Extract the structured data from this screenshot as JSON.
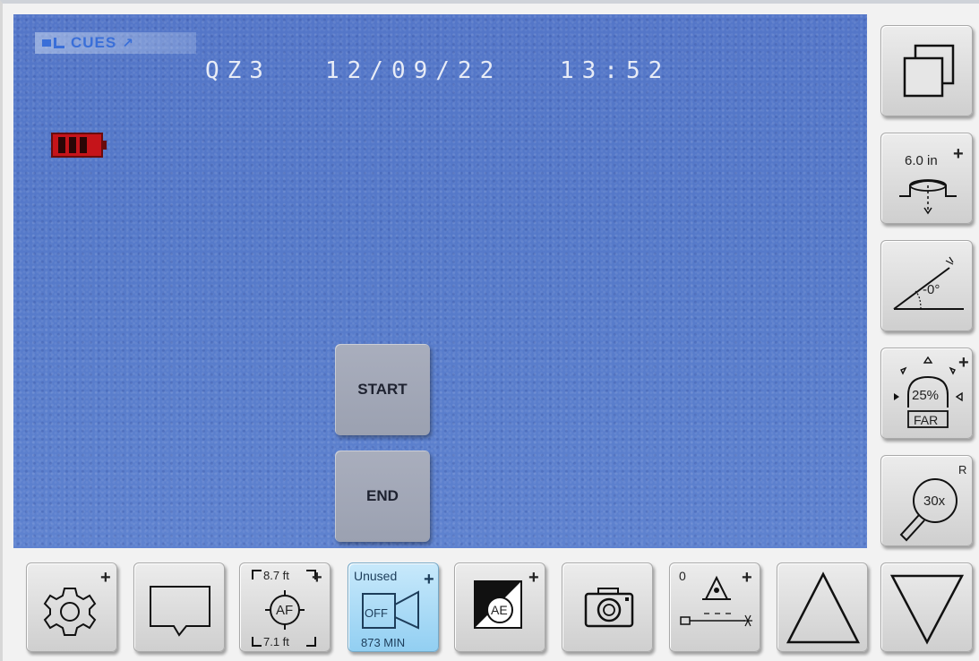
{
  "overlay": {
    "logo_text": "CUES",
    "camera_id": "QZ3",
    "date": "12/09/22",
    "time": "13:52"
  },
  "center_buttons": {
    "start_label": "START",
    "end_label": "END"
  },
  "right_toolbar": {
    "pipe_size_value": "6.0 in",
    "pipe_size_plus": "+",
    "incline_value": "-0°",
    "light_value": "25%",
    "light_mode": "FAR",
    "light_plus": "+",
    "zoom_value": "30x",
    "zoom_reset": "R"
  },
  "bottom_toolbar": {
    "settings_plus": "+",
    "focus_far": "8.7 ft",
    "focus_near": "7.1 ft",
    "focus_label": "AF",
    "focus_plus": "+",
    "record_status": "Unused",
    "record_state": "OFF",
    "record_remaining": "873 MIN",
    "record_plus": "+",
    "exposure_label": "AE",
    "exposure_plus": "+",
    "laser_zero": "0",
    "laser_plus": "+"
  },
  "icons": [
    "windows-icon",
    "pipe-size-icon",
    "incline-icon",
    "light-dome-icon",
    "zoom-magnifier-icon",
    "settings-gear-icon",
    "comment-bubble-icon",
    "autofocus-icon",
    "video-camera-icon",
    "exposure-icon",
    "photo-camera-icon",
    "laser-measure-icon",
    "triangle-up-icon",
    "triangle-down-icon"
  ],
  "colors": {
    "viewport_blue": "#5579c9",
    "battery_red": "#c5141a",
    "record_blue": "#a8dcf7"
  }
}
